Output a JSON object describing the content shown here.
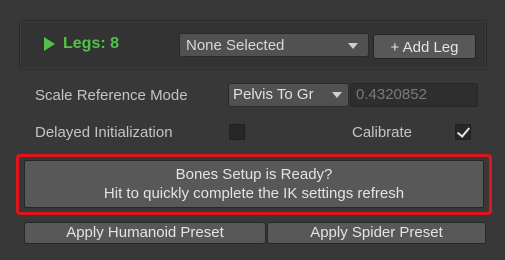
{
  "legs": {
    "title": "Legs: 8",
    "selected_leg": "None Selected",
    "add_leg_label": "+ Add Leg"
  },
  "scale": {
    "label": "Scale Reference Mode",
    "mode": "Pelvis To Gr",
    "value": "0.4320852"
  },
  "delayed_init": {
    "label": "Delayed Initialization",
    "checked": false
  },
  "calibrate": {
    "label": "Calibrate",
    "checked": true
  },
  "bones_button": {
    "line1": "Bones Setup is Ready?",
    "line2": "Hit to quickly complete the IK settings refresh"
  },
  "presets": {
    "humanoid_label": "Apply Humanoid Preset",
    "spider_label": "Apply Spider Preset"
  },
  "colors": {
    "accent_green": "#52c24a",
    "highlight_red": "#e0141d"
  }
}
